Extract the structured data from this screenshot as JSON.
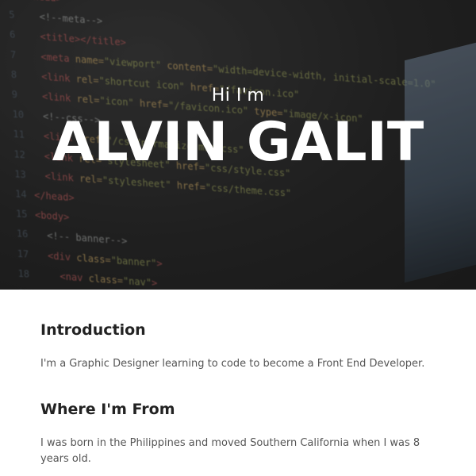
{
  "hero": {
    "greeting": "Hi I'm",
    "name": "ALVIN GALIT"
  },
  "sections": [
    {
      "heading": "Introduction",
      "body": "I'm a Graphic Designer learning to code to become a Front End Developer."
    },
    {
      "heading": "Where I'm From",
      "body": "I was born in the Philippines and moved Southern California when I was 8 years old."
    }
  ]
}
